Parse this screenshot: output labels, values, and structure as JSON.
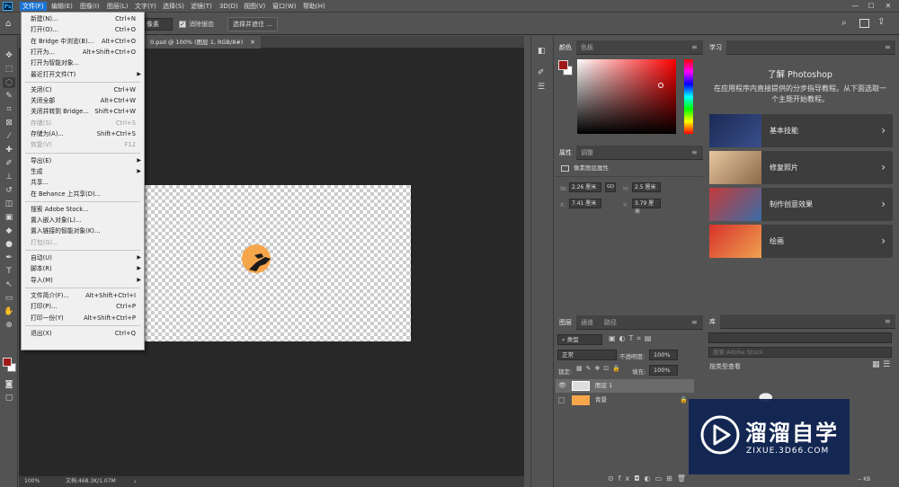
{
  "menubar": {
    "logo": "Ps",
    "items": [
      "文件(F)",
      "编辑(E)",
      "图像(I)",
      "图层(L)",
      "文字(Y)",
      "选择(S)",
      "滤镜(T)",
      "3D(D)",
      "视图(V)",
      "窗口(W)",
      "帮助(H)"
    ],
    "window_controls": [
      "—",
      "☐",
      "✕"
    ]
  },
  "options": {
    "style_value": "像素",
    "remove_aliasing_label": "消除锯齿",
    "select_mask_button": "选择并遮住 ..."
  },
  "document": {
    "tab_title": "0.psd @ 100% (图层 1, RGB/8#)",
    "tab_close": "✕",
    "zoom": "100%",
    "doc_info": "文档:468.3K/1.07M"
  },
  "file_menu": {
    "items": [
      {
        "label": "新建(N)...",
        "shortcut": "Ctrl+N"
      },
      {
        "label": "打开(O)...",
        "shortcut": "Ctrl+O"
      },
      {
        "label": "在 Bridge 中浏览(B)...",
        "shortcut": "Alt+Ctrl+O"
      },
      {
        "label": "打开为...",
        "shortcut": "Alt+Shift+Ctrl+O"
      },
      {
        "label": "打开为智能对象...",
        "shortcut": ""
      },
      {
        "label": "最近打开文件(T)",
        "shortcut": "",
        "submenu": true
      },
      {
        "label": "关闭(C)",
        "shortcut": "Ctrl+W"
      },
      {
        "label": "关闭全部",
        "shortcut": "Alt+Ctrl+W"
      },
      {
        "label": "关闭并转到 Bridge...",
        "shortcut": "Shift+Ctrl+W"
      },
      {
        "label": "存储(S)",
        "shortcut": "Ctrl+S",
        "disabled": true
      },
      {
        "label": "存储为(A)...",
        "shortcut": "Shift+Ctrl+S"
      },
      {
        "label": "恢复(V)",
        "shortcut": "F12",
        "disabled": true
      },
      {
        "label": "导出(E)",
        "shortcut": "",
        "submenu": true
      },
      {
        "label": "生成",
        "shortcut": "",
        "submenu": true
      },
      {
        "label": "共享...",
        "shortcut": ""
      },
      {
        "label": "在 Behance 上共享(D)...",
        "shortcut": ""
      },
      {
        "label": "搜索 Adobe Stock...",
        "shortcut": ""
      },
      {
        "label": "置入嵌入对象(L)...",
        "shortcut": ""
      },
      {
        "label": "置入链接的智能对象(K)...",
        "shortcut": ""
      },
      {
        "label": "打包(G)...",
        "shortcut": "",
        "disabled": true
      },
      {
        "label": "自动(U)",
        "shortcut": "",
        "submenu": true
      },
      {
        "label": "脚本(R)",
        "shortcut": "",
        "submenu": true
      },
      {
        "label": "导入(M)",
        "shortcut": "",
        "submenu": true
      },
      {
        "label": "文件简介(F)...",
        "shortcut": "Alt+Shift+Ctrl+I"
      },
      {
        "label": "打印(P)...",
        "shortcut": "Ctrl+P"
      },
      {
        "label": "打印一份(Y)",
        "shortcut": "Alt+Shift+Ctrl+P"
      },
      {
        "label": "退出(X)",
        "shortcut": "Ctrl+Q"
      }
    ]
  },
  "color_panel": {
    "tabs": [
      "颜色",
      "色板"
    ],
    "foreground": "#a01818",
    "background": "#ffffff",
    "picker_hue": "#ff0000"
  },
  "properties_panel": {
    "tabs": [
      "属性",
      "调整"
    ],
    "section_title": "像素图层属性",
    "W": "2.26 厘米",
    "H": "2.5 厘米",
    "X": "7.41 厘米",
    "Y": "3.79 厘米",
    "W_label": "W:",
    "H_label": "H:",
    "X_label": "X:",
    "Y_label": "Y:",
    "link": "GO"
  },
  "layers_panel": {
    "tabs": [
      "图层",
      "通道",
      "路径"
    ],
    "filter_kind": "类型",
    "blend_mode": "正常",
    "opacity_label": "不透明度:",
    "opacity": "100%",
    "lock_label": "锁定:",
    "fill_label": "填充:",
    "fill": "100%",
    "layers": [
      "图层 1",
      "背景"
    ]
  },
  "learn_panel": {
    "tab": "学习",
    "title": "了解 Photoshop",
    "description": "在应用程序内直接提供的分步指导教程。从下面选取一个主题开始教程。",
    "cards": [
      "基本技能",
      "修复照片",
      "制作创意效果",
      "绘画"
    ]
  },
  "library_panel": {
    "tab": "库",
    "search_placeholder": "搜索 Adobe Stock",
    "view_label": "按类型查看",
    "size": "-- KB"
  },
  "watermark": {
    "title": "溜溜自学",
    "url": "ZIXUE.3D66.COM"
  },
  "colors": {
    "accent": "#1c74d4",
    "orange": "#f5a54a",
    "arrow": "#e8323a"
  }
}
